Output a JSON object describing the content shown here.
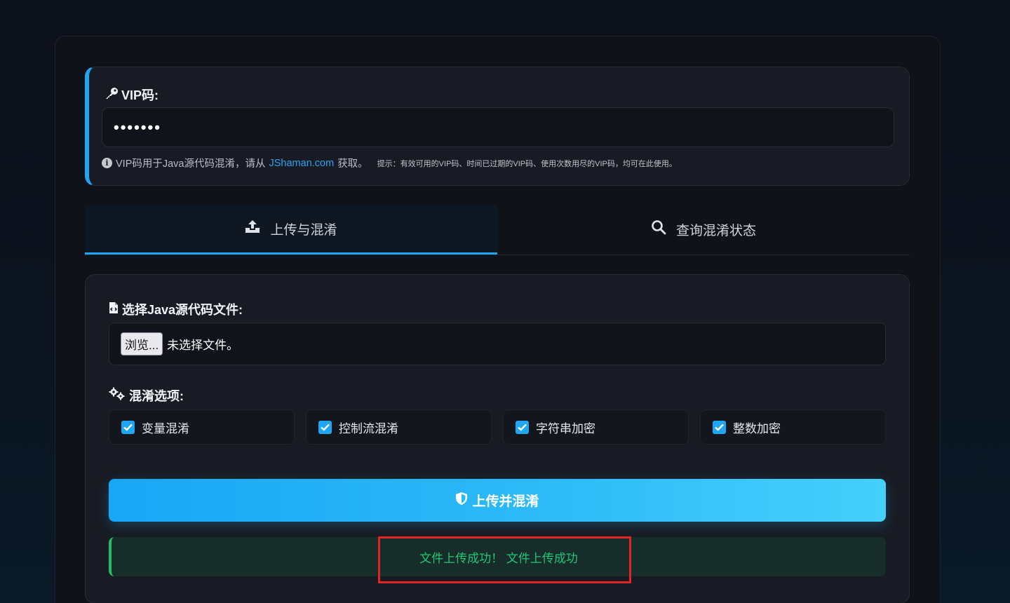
{
  "vip": {
    "label": "VIP码:",
    "value": "•••••••",
    "help_prefix": "VIP码用于Java源代码混淆，请从",
    "help_link": "JShaman.com",
    "help_suffix": "获取。",
    "tip": "提示：有效可用的VIP码、时间已过期的VIP码、使用次数用尽的VIP码，均可在此使用。"
  },
  "tabs": [
    {
      "label": "上传与混淆",
      "icon": "upload-icon",
      "active": true
    },
    {
      "label": "查询混淆状态",
      "icon": "search-icon",
      "active": false
    }
  ],
  "upload": {
    "file_label": "选择Java源代码文件:",
    "browse_label": "浏览...",
    "file_status": "未选择文件。",
    "options_label": "混淆选项:",
    "options": [
      {
        "label": "变量混淆",
        "checked": true
      },
      {
        "label": "控制流混淆",
        "checked": true
      },
      {
        "label": "字符串加密",
        "checked": true
      },
      {
        "label": "整数加密",
        "checked": true
      }
    ],
    "submit_label": "上传并混淆",
    "success_message": "文件上传成功！ 文件上传成功"
  },
  "colors": {
    "accent": "#1ea7f0",
    "success": "#1fc775",
    "highlight": "#e32425"
  }
}
